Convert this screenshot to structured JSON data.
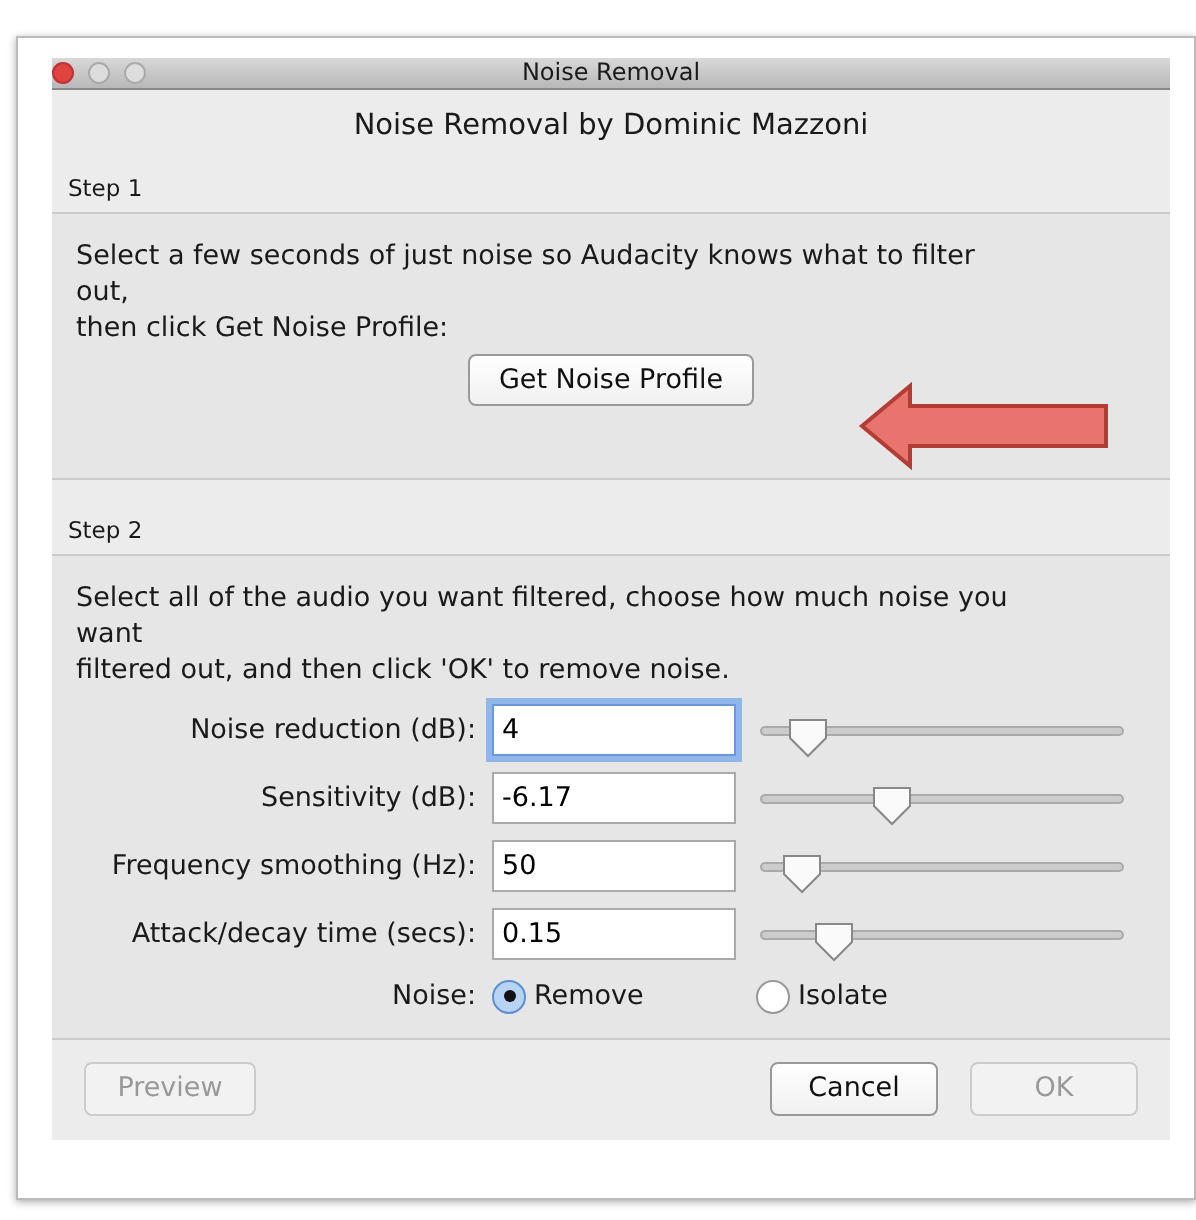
{
  "window": {
    "title": "Noise Removal"
  },
  "heading": "Noise Removal by Dominic Mazzoni",
  "step1": {
    "label": "Step 1",
    "lines": [
      "Select a few seconds of just noise so Audacity knows what to filter",
      "out,",
      "then click Get Noise Profile:"
    ],
    "button": "Get Noise Profile"
  },
  "step2": {
    "label": "Step 2",
    "lines": [
      "Select all of the audio you want filtered, choose how much noise you",
      "want",
      "filtered out, and then click 'OK' to remove noise."
    ],
    "settings": [
      {
        "label": "Noise reduction (dB):",
        "value": "4",
        "focused": true,
        "level": 0.13
      },
      {
        "label": "Sensitivity (dB):",
        "value": "-6.17",
        "focused": false,
        "level": 0.36
      },
      {
        "label": "Frequency smoothing (Hz):",
        "value": "50",
        "focused": false,
        "level": 0.11
      },
      {
        "label": "Attack/decay time (secs):",
        "value": "0.15",
        "focused": false,
        "level": 0.2
      }
    ],
    "noise": {
      "label": "Noise:",
      "options": [
        {
          "label": "Remove",
          "selected": true
        },
        {
          "label": "Isolate",
          "selected": false
        }
      ]
    }
  },
  "buttons": [
    {
      "label": "Preview",
      "disabled": true
    },
    {
      "label": "Cancel",
      "disabled": false
    },
    {
      "label": "OK",
      "disabled": true
    }
  ]
}
